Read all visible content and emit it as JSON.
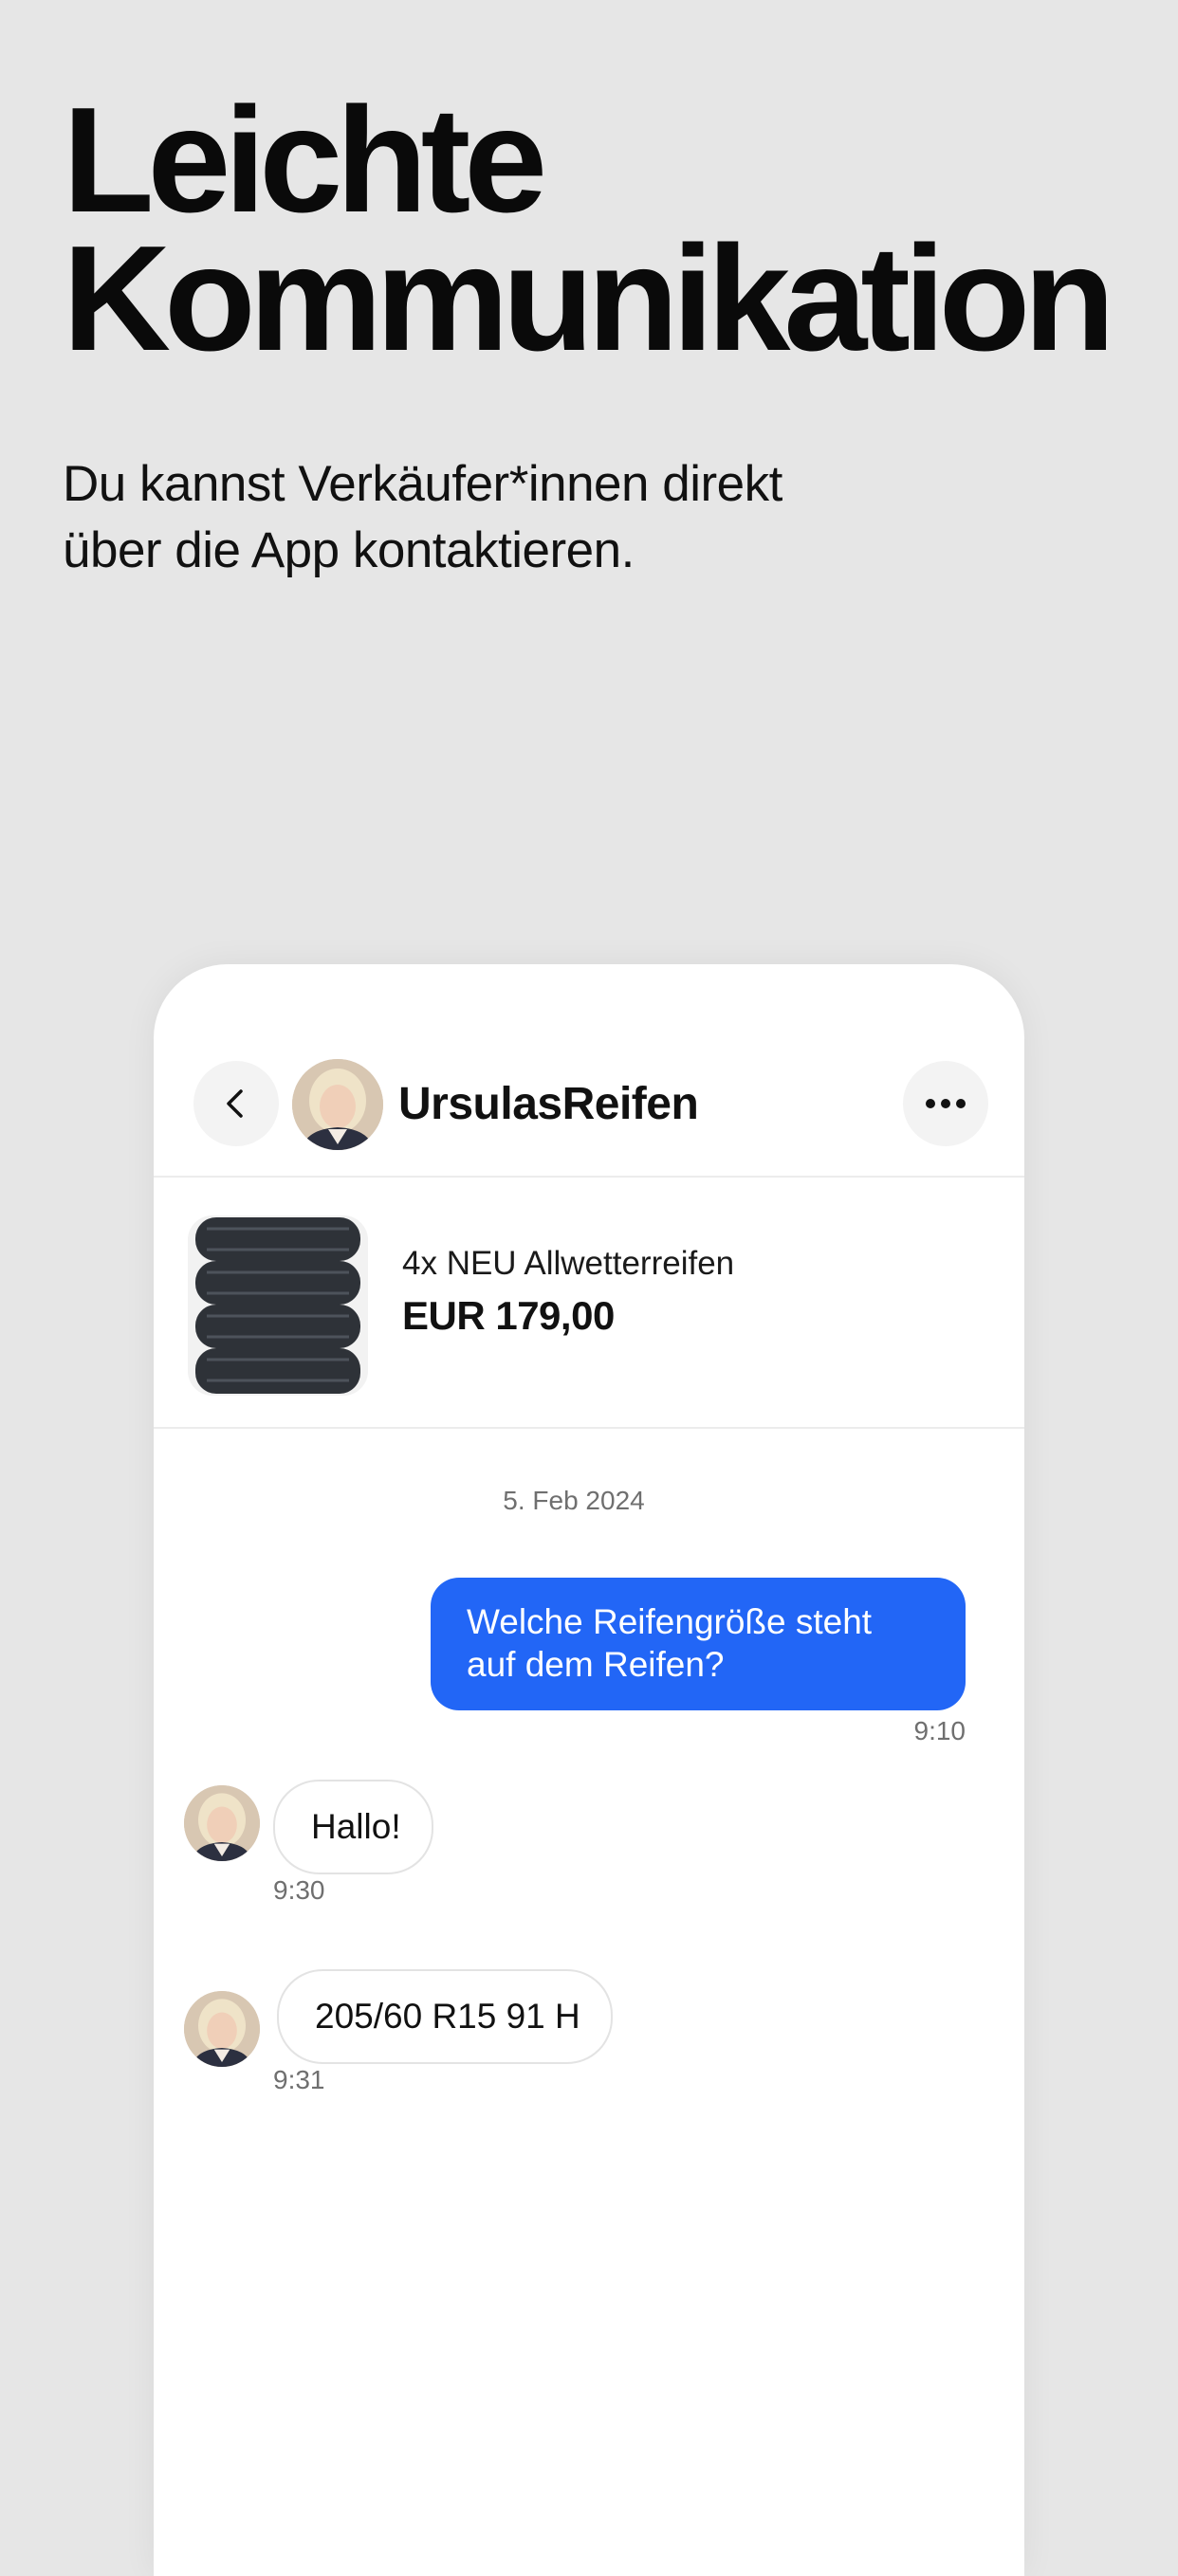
{
  "promo": {
    "headline_line1": "Leichte",
    "headline_line2": "Kommunikation",
    "subtitle_line1": "Du kannst Verkäufer*innen direkt",
    "subtitle_line2": "über die App kontaktieren."
  },
  "chat": {
    "header": {
      "back_icon": "chevron-left-icon",
      "contact_name": "UrsulasReifen",
      "more_icon": "more-horizontal-icon"
    },
    "listing": {
      "title": "4x NEU Allwetterreifen",
      "price": "EUR 179,00",
      "image": "stacked-tires-photo"
    },
    "date_separator": "5. Feb 2024",
    "messages": [
      {
        "direction": "outgoing",
        "text": "Welche Reifengröße steht auf dem Reifen?",
        "time": "9:10"
      },
      {
        "direction": "incoming",
        "text": "Hallo!",
        "time": "9:30"
      },
      {
        "direction": "incoming",
        "text": "205/60 R15 91 H",
        "time": "9:31"
      }
    ]
  },
  "colors": {
    "background": "#e6e6e6",
    "outgoing_bubble": "#2266f6",
    "incoming_bubble_border": "#e3e3e3",
    "timestamp": "#6f6f6f"
  }
}
